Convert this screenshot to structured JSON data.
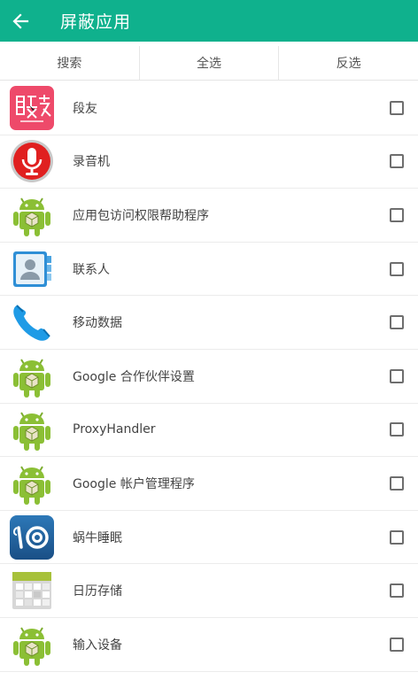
{
  "header": {
    "title": "屏蔽应用",
    "back_icon": "arrow-left-icon"
  },
  "tabs": [
    {
      "label": "搜索"
    },
    {
      "label": "全选"
    },
    {
      "label": "反选"
    }
  ],
  "apps": [
    {
      "name": "段友",
      "icon": "duanyou-app-icon",
      "checked": false
    },
    {
      "name": "录音机",
      "icon": "microphone-app-icon",
      "checked": false
    },
    {
      "name": "应用包访问权限帮助程序",
      "icon": "android-robot-icon",
      "checked": false
    },
    {
      "name": "联系人",
      "icon": "contacts-app-icon",
      "checked": false
    },
    {
      "name": "移动数据",
      "icon": "phone-app-icon",
      "checked": false
    },
    {
      "name": "Google 合作伙伴设置",
      "icon": "android-robot-icon",
      "checked": false
    },
    {
      "name": "ProxyHandler",
      "icon": "android-robot-icon",
      "checked": false
    },
    {
      "name": "Google 帐户管理程序",
      "icon": "android-robot-icon",
      "checked": false
    },
    {
      "name": "蜗牛睡眠",
      "icon": "snail-sleep-app-icon",
      "checked": false
    },
    {
      "name": "日历存储",
      "icon": "calendar-storage-app-icon",
      "checked": false
    },
    {
      "name": "输入设备",
      "icon": "android-robot-icon",
      "checked": false
    }
  ],
  "colors": {
    "appbar": "#0fb18d",
    "duanyou_bg": "#ee4a6a"
  }
}
